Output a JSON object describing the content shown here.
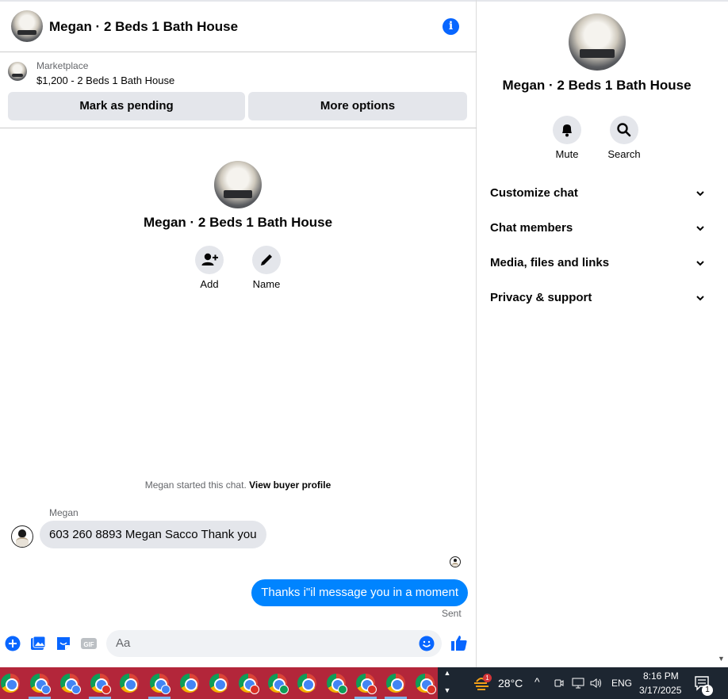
{
  "header": {
    "title": "Megan · 2 Beds 1 Bath House"
  },
  "listing": {
    "label": "Marketplace",
    "title": "$1,200 - 2 Beds 1 Bath House",
    "pending_button": "Mark as pending",
    "more_button": "More options"
  },
  "intro": {
    "title": "Megan · 2 Beds 1 Bath House",
    "actions": [
      {
        "label": "Add",
        "icon": "add-person-icon"
      },
      {
        "label": "Name",
        "icon": "pencil-icon"
      }
    ]
  },
  "conversation": {
    "started_text": "Megan started this chat.",
    "buyer_profile_link": "View buyer profile",
    "sender_name": "Megan",
    "incoming_message": "603 260 8893 Megan Sacco Thank you",
    "outgoing_message": "Thanks i\"il message you in a moment",
    "status": "Sent"
  },
  "composer": {
    "placeholder": "Aa"
  },
  "panel": {
    "title": "Megan · 2 Beds 1 Bath House",
    "actions": [
      {
        "label": "Mute",
        "icon": "bell-icon"
      },
      {
        "label": "Search",
        "icon": "search-icon"
      }
    ],
    "sections": [
      "Customize chat",
      "Chat members",
      "Media, files and links",
      "Privacy & support"
    ]
  },
  "taskbar": {
    "weather": "28°C",
    "notification_count": "1",
    "language": "ENG",
    "time": "8:16 PM",
    "date": "3/17/2025",
    "action_center_count": "1"
  },
  "colors": {
    "accent": "#0866ff",
    "outgoing_bubble": "#0084ff",
    "button_bg": "#e4e6eb"
  }
}
